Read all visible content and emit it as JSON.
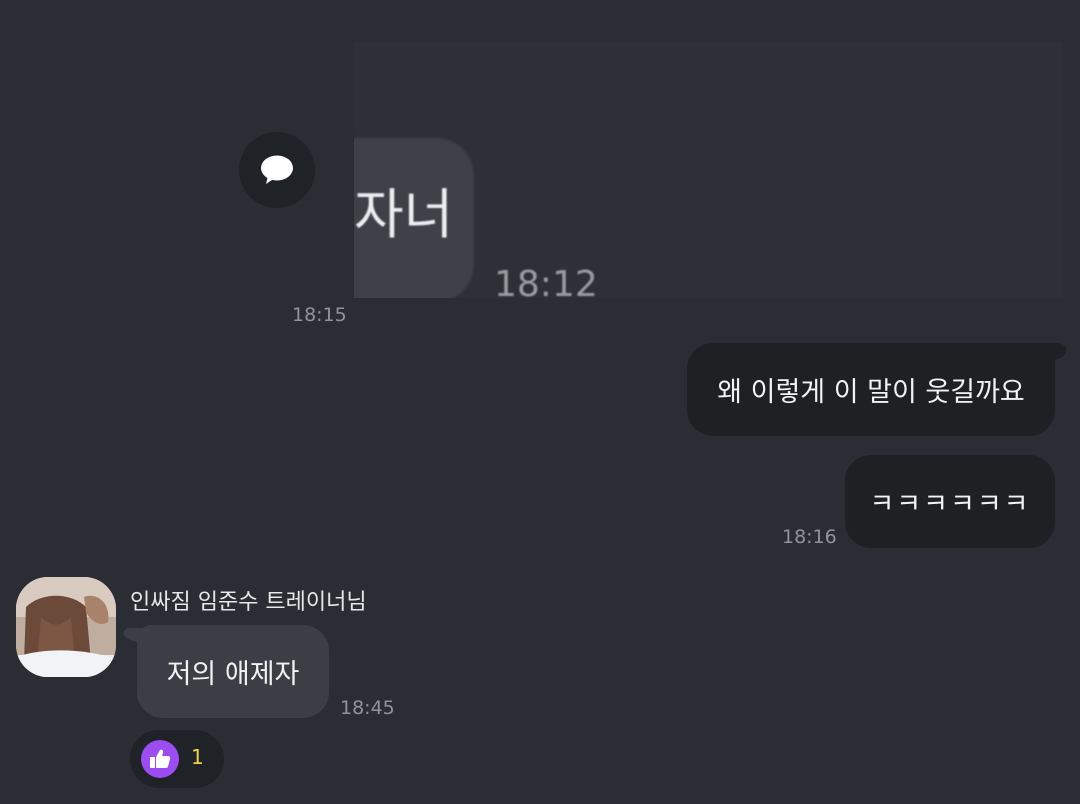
{
  "shared_image": {
    "bubble_text": "자너",
    "time": "18:12",
    "share_icon": "speech-bubble-icon"
  },
  "shared_time": "18:15",
  "outgoing": {
    "messages": [
      {
        "text": "왜 이렇게 이 말이 웃길까요"
      },
      {
        "text": "ㅋㅋㅋㅋㅋㅋ"
      }
    ],
    "time": "18:16"
  },
  "incoming": {
    "sender_name": "인싸짐 임준수 트레이너님",
    "message": "저의 애제자",
    "time": "18:45",
    "reaction": {
      "icon": "thumbs-up-icon",
      "count": "1",
      "color": "#9b4df0"
    }
  },
  "colors": {
    "background": "#2a2d33",
    "outgoing_bubble": "#1e2024",
    "incoming_bubble": "#3b3e44",
    "reaction_count": "#f2d148"
  }
}
